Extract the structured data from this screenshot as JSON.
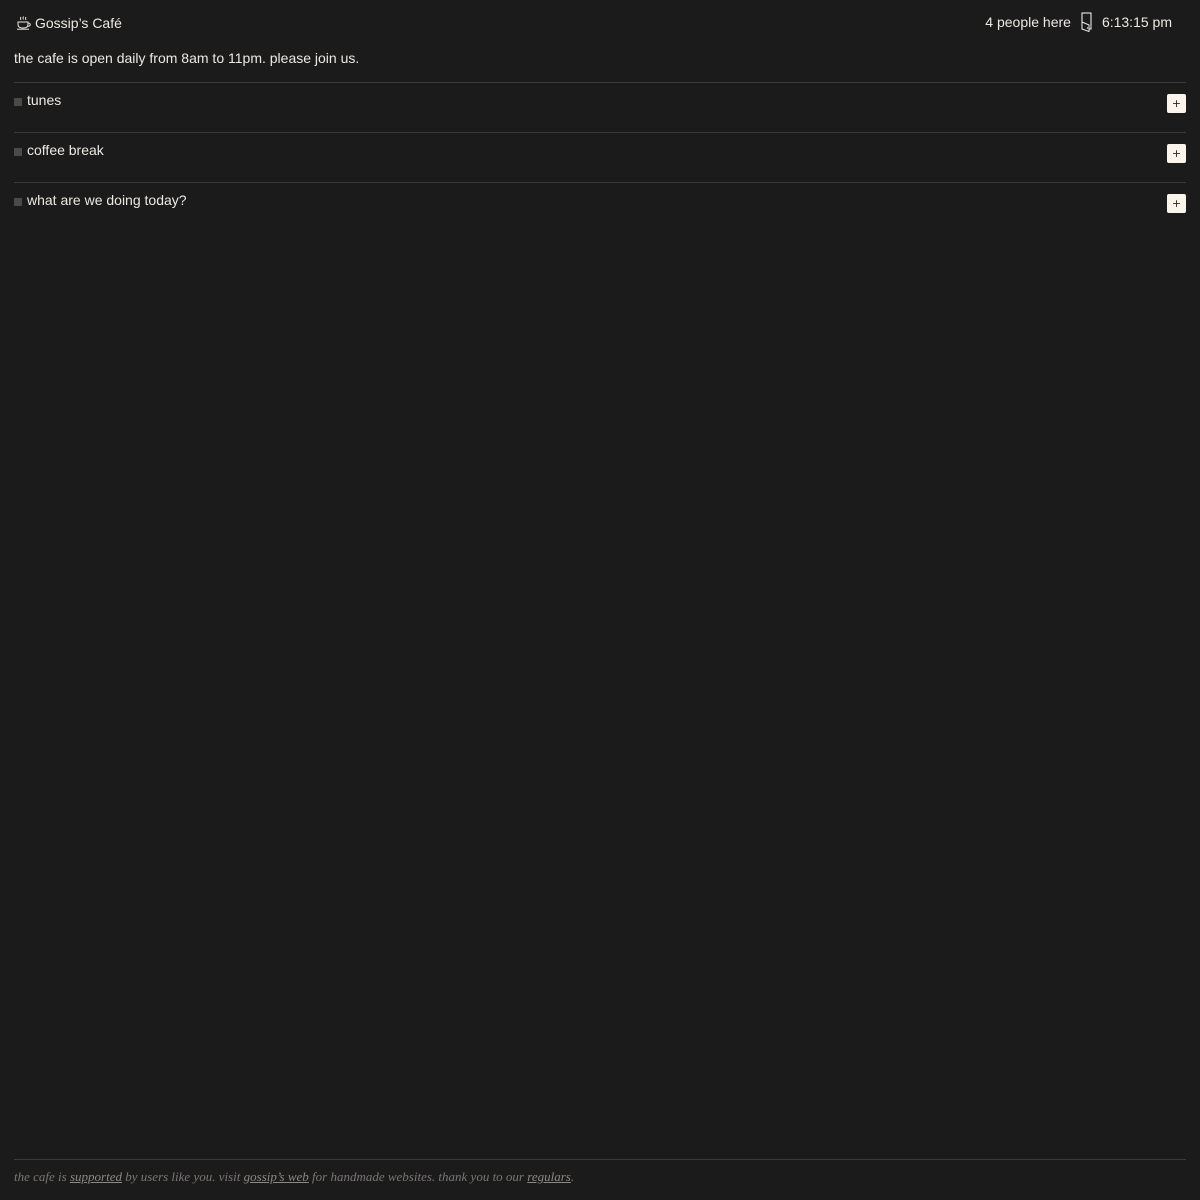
{
  "header": {
    "cafe_name": "Gossip’s Café",
    "cafe_icon": "coffee-cup-icon",
    "people_count": "4 people here",
    "door_icon": "door-icon",
    "time": "6:13:15 pm"
  },
  "notice": "the cafe is open daily from 8am to 11pm. please join us.",
  "rooms": [
    {
      "label": "tunes",
      "add_label": "+"
    },
    {
      "label": "coffee break",
      "add_label": "+"
    },
    {
      "label": "what are we doing today?",
      "add_label": "+"
    }
  ],
  "footer": {
    "part1": "the cafe is ",
    "link1": "supported",
    "part2": " by users like you. visit ",
    "link2": "gossip’s web",
    "part3": " for handmade websites. thank you to our ",
    "link3": "regulars",
    "part4": "."
  },
  "colors": {
    "background": "#1b1b1b",
    "text": "#ece9e4",
    "button_bg": "#fbf4ea",
    "divider": "#3a3a3a",
    "footer_text": "#7b7873"
  }
}
